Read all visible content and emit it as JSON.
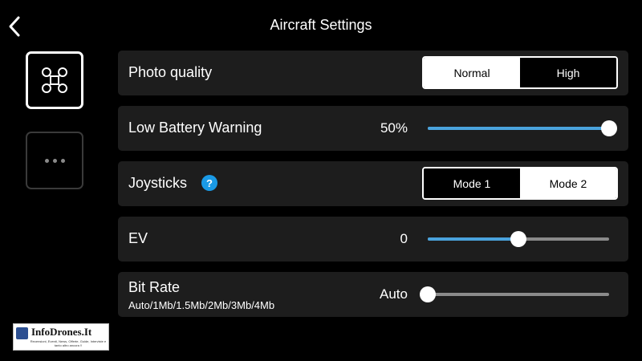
{
  "header": {
    "title": "Aircraft Settings"
  },
  "sidebar": {
    "items": [
      {
        "icon": "drone-icon",
        "active": true
      },
      {
        "icon": "more-icon",
        "active": false
      }
    ]
  },
  "settings": {
    "photo_quality": {
      "label": "Photo quality",
      "options": [
        "Normal",
        "High"
      ],
      "selected": "Normal"
    },
    "low_battery": {
      "label": "Low Battery Warning",
      "value": "50%",
      "level": 1.0
    },
    "joysticks": {
      "label": "Joysticks",
      "options": [
        "Mode 1",
        "Mode 2"
      ],
      "selected": "Mode 1",
      "help_icon": "?"
    },
    "ev": {
      "label": "EV",
      "value": "0",
      "level": 0.5
    },
    "bit_rate": {
      "label": "Bit Rate",
      "sub": "Auto/1Mb/1.5Mb/2Mb/3Mb/4Mb",
      "value": "Auto",
      "level": 0.0
    }
  },
  "watermark": {
    "title": "InfoDrones.It",
    "sub": "Recensioni, Eventi, News, Offerte, Guide, Interviste e tanto altro ancora !!"
  },
  "colors": {
    "background": "#000000",
    "row": "#1d1d1d",
    "accent": "#4aa3dd",
    "help": "#1a9ae6"
  }
}
